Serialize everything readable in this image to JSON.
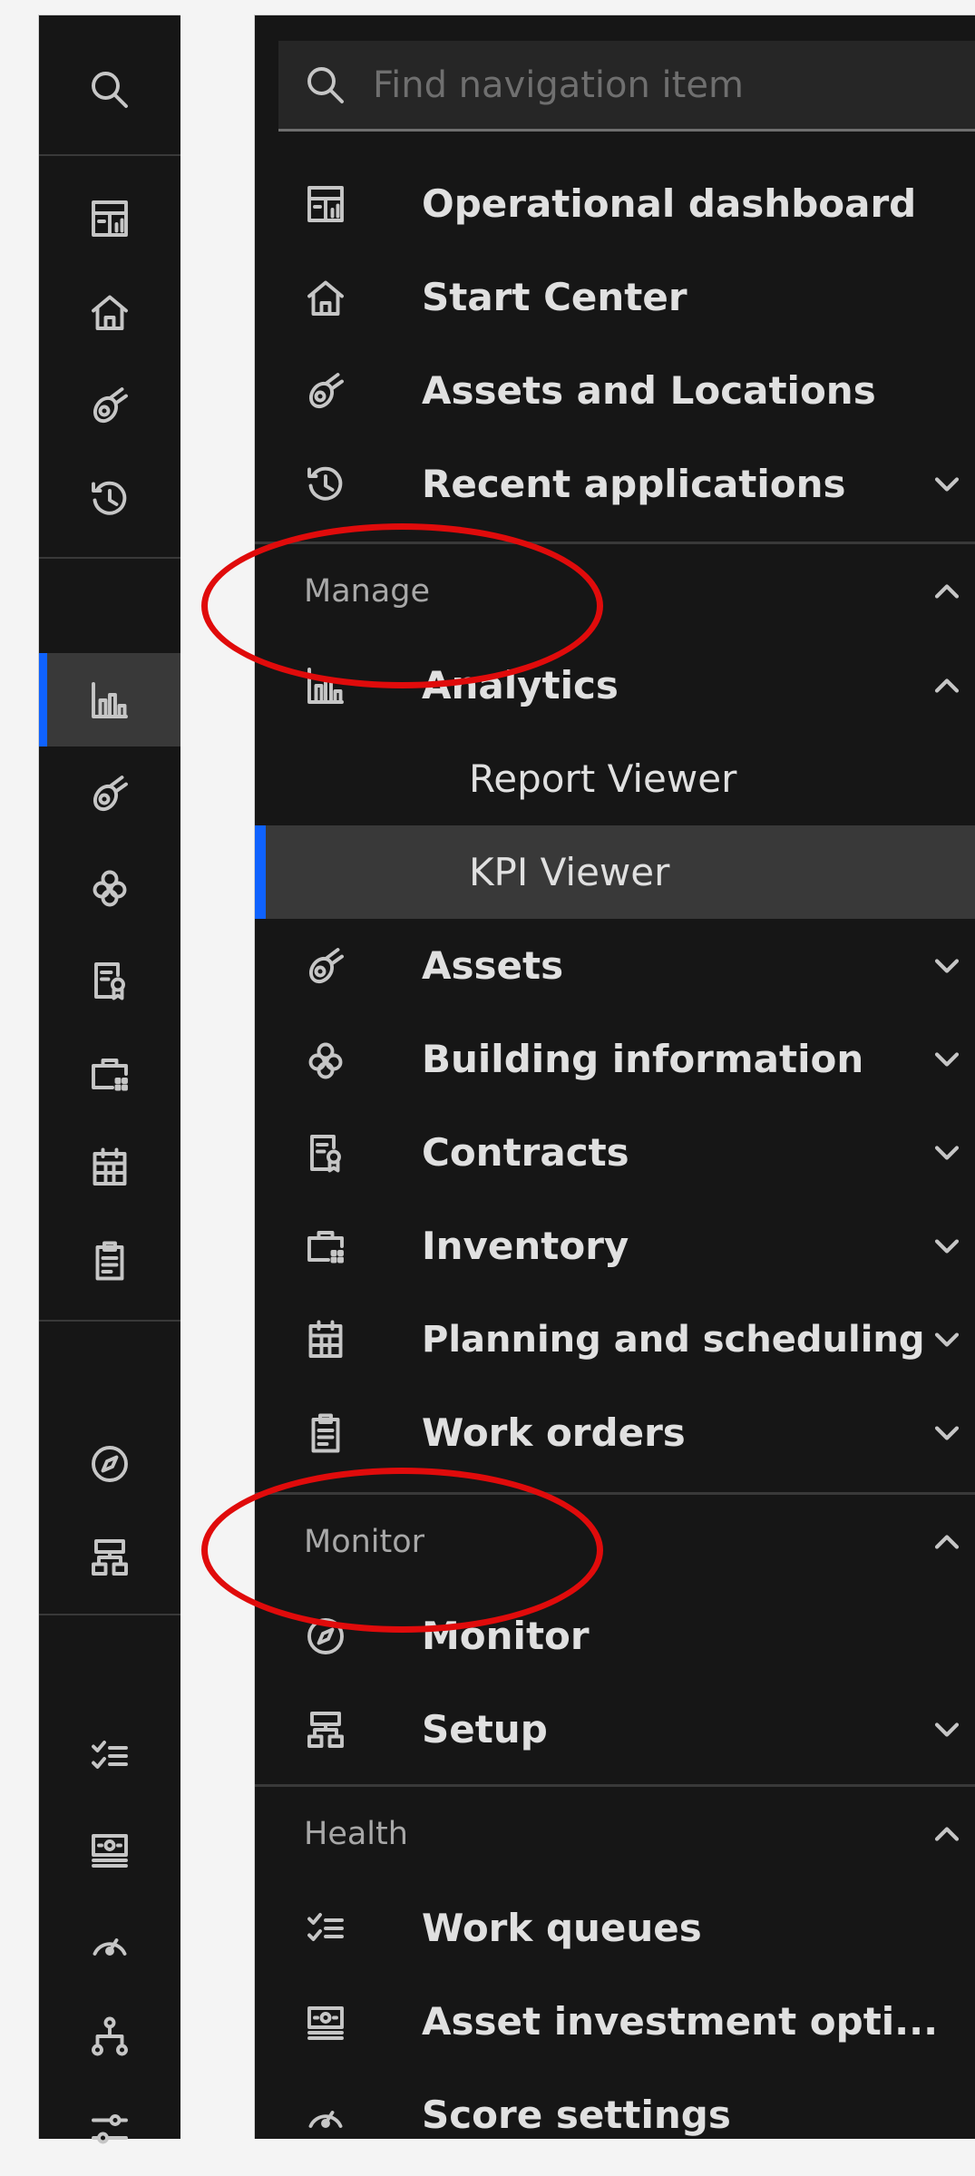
{
  "search": {
    "placeholder": "Find navigation item",
    "value": ""
  },
  "rail_icons": [
    "search-icon",
    "dashboard-icon",
    "home-icon",
    "asset-icon",
    "history-icon",
    "analytics-icon",
    "asset-icon",
    "building-icon",
    "contract-icon",
    "inventory-icon",
    "calendar-icon",
    "clipboard-icon",
    "compass-icon",
    "hierarchy-icon",
    "checklist-icon",
    "investment-icon",
    "gauge-icon",
    "tree-icon",
    "sliders-icon"
  ],
  "items": {
    "operational_dashboard": "Operational dashboard",
    "start_center": "Start Center",
    "assets_and_locations": "Assets and Locations",
    "recent_applications": "Recent applications"
  },
  "manage": {
    "section": "Manage",
    "analytics": "Analytics",
    "report_viewer": "Report Viewer",
    "kpi_viewer": "KPI Viewer",
    "assets": "Assets",
    "building_information": "Building information",
    "contracts": "Contracts",
    "inventory": "Inventory",
    "planning_and_scheduling": "Planning and scheduling",
    "work_orders": "Work orders"
  },
  "monitor": {
    "section": "Monitor",
    "monitor": "Monitor",
    "setup": "Setup"
  },
  "health": {
    "section": "Health",
    "work_queues": "Work queues",
    "asset_investment": "Asset investment opti...",
    "score_settings": "Score settings"
  },
  "colors": {
    "accent": "#0f62fe",
    "annotation": "#e00b0b",
    "background": "#161616"
  }
}
